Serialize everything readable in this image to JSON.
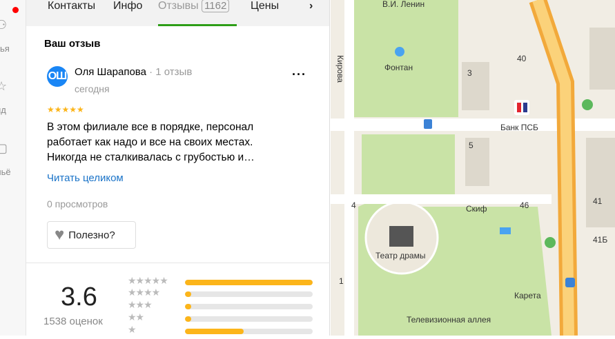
{
  "sidebar": {
    "labels": [
      "зья",
      "ид",
      "льё"
    ],
    "notification_dot": "#ff0000"
  },
  "tabs": [
    {
      "label": "Контакты"
    },
    {
      "label": "Инфо"
    },
    {
      "label": "Отзывы",
      "count": "1162",
      "active": true
    },
    {
      "label": "Цены"
    }
  ],
  "review": {
    "heading": "Ваш отзыв",
    "avatar_initials": "ОШ",
    "author": "Оля Шарапова",
    "author_reviews": "1 отзыв",
    "date": "сегодня",
    "stars": 5,
    "text": "В этом филиале все в порядке, персонал работает как надо и все на своих местах. Никогда не сталкивалась с грубостью и…",
    "read_more": "Читать целиком",
    "views": "0 просмотров",
    "useful": "Полезно?"
  },
  "rating": {
    "score": "3.6",
    "count_label": "1538 оценок",
    "distribution": [
      {
        "stars": 5,
        "fraction": 1.0
      },
      {
        "stars": 4,
        "fraction": 0.04
      },
      {
        "stars": 3,
        "fraction": 0.03
      },
      {
        "stars": 2,
        "fraction": 0.05
      },
      {
        "stars": 1,
        "fraction": 0.46
      }
    ],
    "bar_color": "#fcb51a"
  },
  "map": {
    "labels": {
      "lenin": "В.И. Ленин",
      "kirova": "Кирова",
      "fontan": "Фонтан",
      "bank": "Банк ПСБ",
      "skif": "Скиф",
      "theatre": "Театр драмы",
      "kareta": "Карета",
      "alley": "Телевизионная аллея",
      "n40": "40",
      "n3": "3",
      "n5": "5",
      "n4": "4",
      "n46": "46",
      "n41": "41",
      "n41b": "41Б",
      "n1": "1"
    }
  }
}
